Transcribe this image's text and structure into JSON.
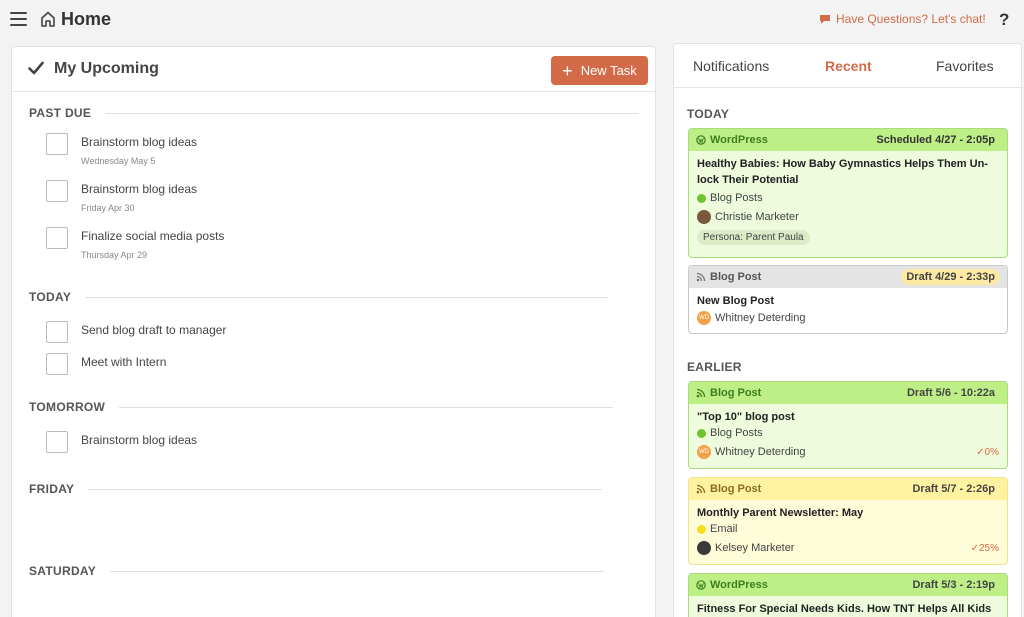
{
  "header": {
    "title": "Home",
    "chat_label": "Have Questions? Let's chat!",
    "help_label": "?"
  },
  "upcoming": {
    "title": "My Upcoming",
    "new_task_label": "New Task",
    "sections": {
      "past_due": "PAST DUE",
      "today": "TODAY",
      "tomorrow": "TOMORROW",
      "friday": "FRIDAY",
      "saturday": "SATURDAY"
    },
    "tasks": [
      {
        "name": "Brainstorm blog ideas",
        "date": "Wednesday May 5"
      },
      {
        "name": "Brainstorm blog ideas",
        "date": "Friday Apr 30"
      },
      {
        "name": "Finalize social media posts",
        "date": "Thursday Apr 29"
      },
      {
        "name": "Send blog draft to manager",
        "date": ""
      },
      {
        "name": "Meet with Intern",
        "date": ""
      },
      {
        "name": "Brainstorm blog ideas",
        "date": ""
      }
    ]
  },
  "activity": {
    "tabs": [
      "Notifications",
      "Recent",
      "Favorites"
    ],
    "active_tab": "Recent",
    "sections": {
      "today": "TODAY",
      "earlier": "EARLIER"
    },
    "cards": [
      {
        "type": "WordPress",
        "status": "Scheduled 4/27 - 2:05p",
        "title": "Healthy Babies: How Baby Gymnastics Helps Them Un-lock Their Potential",
        "category": "Blog Posts",
        "author": "Christie Marketer",
        "persona": "Persona: Parent Paula",
        "color": "#bdef86"
      },
      {
        "type": "Blog Post",
        "status": "Draft 4/29 - 2:33p",
        "title": "New Blog Post",
        "author": "Whitney Deterding",
        "author_initials": "WD",
        "color": "#e4e4e4"
      },
      {
        "type": "Blog Post",
        "status": "Draft 5/6 - 10:22a",
        "title": "\"Top 10\" blog post",
        "category": "Blog Posts",
        "author": "Whitney Deterding",
        "author_initials": "WD",
        "progress": "0%",
        "color": "#bdef86"
      },
      {
        "type": "Blog Post",
        "status": "Draft 5/7 - 2:26p",
        "title": "Monthly Parent Newsletter: May",
        "category": "Email",
        "author": "Kelsey Marketer",
        "progress": "25%",
        "color": "#fff3a2"
      },
      {
        "type": "WordPress",
        "status": "Draft 5/3 - 2:19p",
        "title": "Fitness For Special Needs Kids. How TNT Helps All Kids",
        "color": "#bdef86"
      }
    ]
  },
  "colors": {
    "accent": "#d36b48",
    "green_dot": "#6cc32b",
    "yellow_dot": "#f5e11b"
  }
}
